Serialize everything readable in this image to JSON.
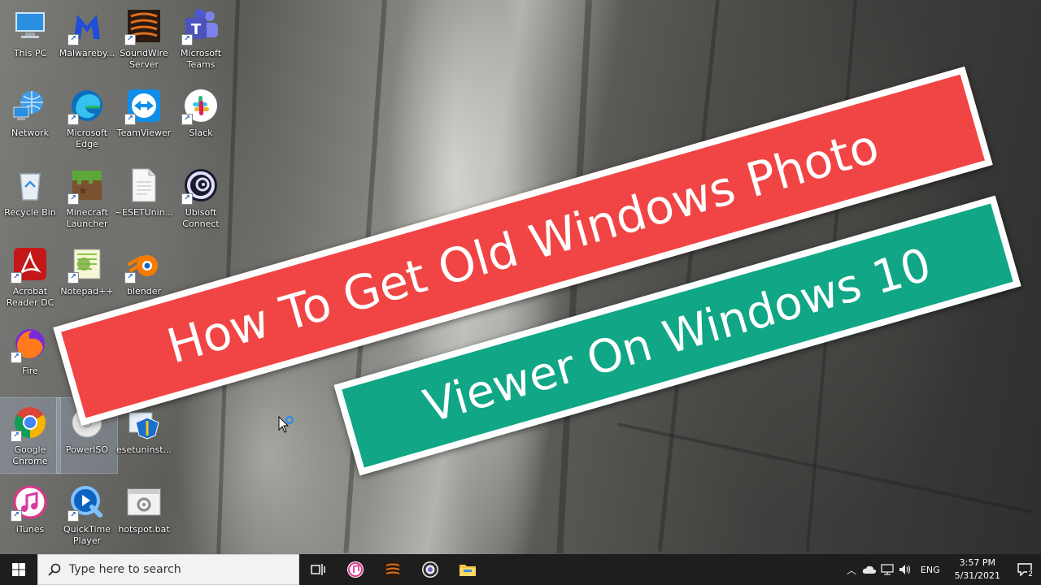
{
  "desktop_icons": [
    {
      "label": "This PC",
      "icon": "this-pc-icon"
    },
    {
      "label": "Malwareby...",
      "icon": "malwarebytes-icon"
    },
    {
      "label": "SoundWire\nServer",
      "icon": "soundwire-icon"
    },
    {
      "label": "Microsoft\nTeams",
      "icon": "teams-icon"
    },
    {
      "label": "Network",
      "icon": "network-icon"
    },
    {
      "label": "Microsoft\nEdge",
      "icon": "edge-icon"
    },
    {
      "label": "TeamViewer",
      "icon": "teamviewer-icon"
    },
    {
      "label": "Slack",
      "icon": "slack-icon"
    },
    {
      "label": "Recycle Bin",
      "icon": "recycle-bin-icon"
    },
    {
      "label": "Minecraft\nLauncher",
      "icon": "minecraft-icon"
    },
    {
      "label": "~ESETUnin...",
      "icon": "document-icon"
    },
    {
      "label": "Ubisoft\nConnect",
      "icon": "ubisoft-icon"
    },
    {
      "label": "Acrobat\nReader DC",
      "icon": "acrobat-icon"
    },
    {
      "label": "Notepad++",
      "icon": "notepadpp-icon"
    },
    {
      "label": "blender",
      "icon": "blender-icon"
    },
    {
      "label": "Fire",
      "icon": "firefox-icon"
    },
    {
      "label": "Google\nChrome",
      "icon": "chrome-icon"
    },
    {
      "label": "PowerISO",
      "icon": "poweriso-icon"
    },
    {
      "label": "esetuninst...",
      "icon": "eset-icon"
    },
    {
      "label": "iTunes",
      "icon": "itunes-icon"
    },
    {
      "label": "QuickTime\nPlayer",
      "icon": "quicktime-icon"
    },
    {
      "label": "hotspot.bat",
      "icon": "bat-file-icon"
    }
  ],
  "banners": {
    "line1": "How To Get Old Windows Photo",
    "line2": "Viewer On Windows 10",
    "line1_color": "#f14545",
    "line2_color": "#10a686"
  },
  "taskbar": {
    "search_placeholder": "Type here to search",
    "pinned": [
      "task-view-icon",
      "itunes-icon",
      "soundwire-icon",
      "obs-icon",
      "file-explorer-icon"
    ],
    "language": "ENG",
    "time": "3:57 PM",
    "date": "5/31/2021",
    "notification_count": "2"
  }
}
